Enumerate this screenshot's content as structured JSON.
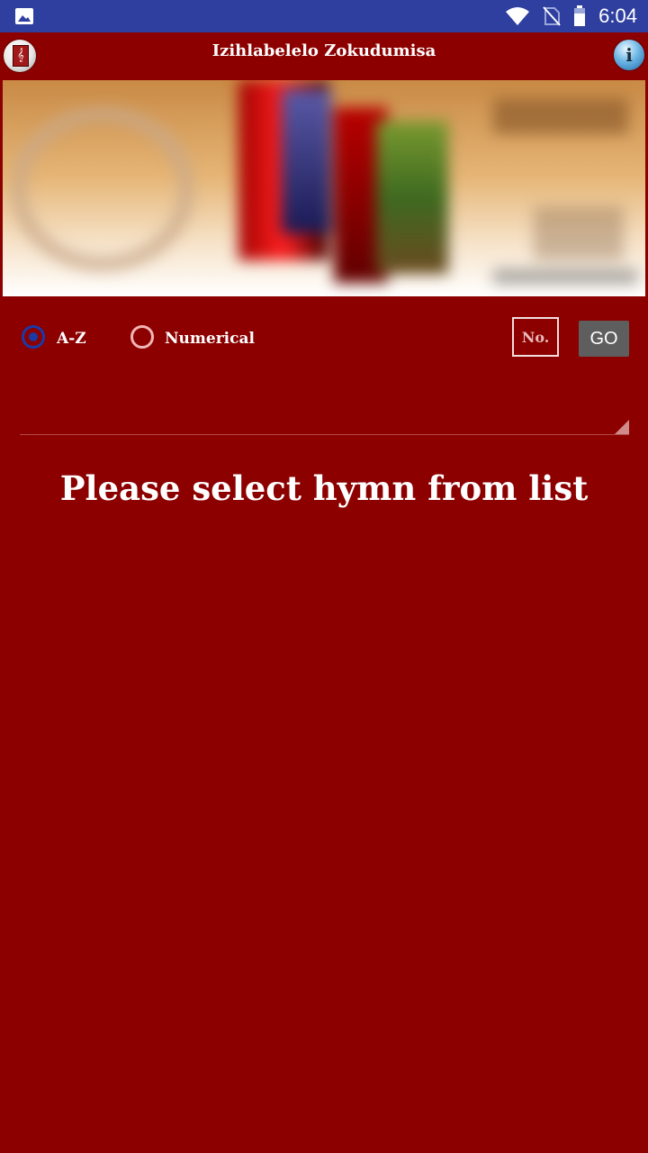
{
  "status_bar": {
    "time": "6:04",
    "icons": [
      "gallery-icon",
      "wifi-icon",
      "no-sim-icon",
      "battery-icon"
    ]
  },
  "header": {
    "title": "Izihlabelelo Zokudumisa",
    "left_icon": "hymnbook-icon",
    "right_icon": "info-icon",
    "info_glyph": "i"
  },
  "sort_options": {
    "az_label": "A-Z",
    "numerical_label": "Numerical",
    "selected": "A-Z"
  },
  "number_search": {
    "placeholder": "No.",
    "value": "",
    "go_label": "GO"
  },
  "hymn_list": {
    "selected_value": ""
  },
  "main": {
    "message": "Please select hymn from list"
  },
  "colors": {
    "background": "#8c0000",
    "status_bar": "#2f3fa0",
    "go_button": "#5e5e5e",
    "radio_accent": "#1a3aa8"
  }
}
